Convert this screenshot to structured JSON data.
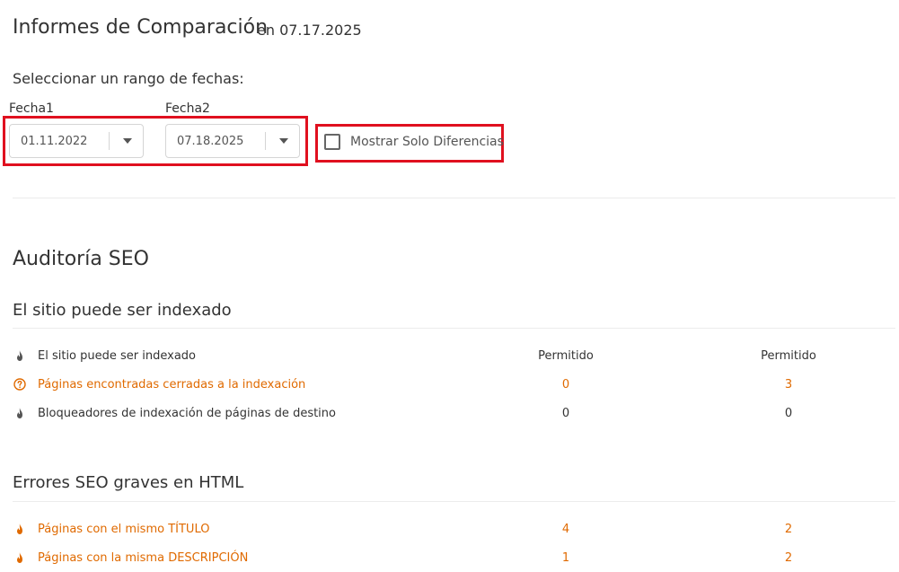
{
  "header": {
    "title": "Informes de Comparación",
    "date": "en 07.17.2025"
  },
  "date_range": {
    "label": "Seleccionar un rango de fechas:",
    "date1_label": "Fecha1",
    "date1_value": "01.11.2022",
    "date2_label": "Fecha2",
    "date2_value": "07.18.2025",
    "only_diff_label": "Mostrar Solo Diferencias",
    "only_diff_checked": false
  },
  "audit": {
    "title": "Auditoría SEO",
    "sections": [
      {
        "title": "El sitio puede ser indexado",
        "rows": [
          {
            "label": "El sitio puede ser indexado",
            "value1": "Permitido",
            "value2": "Permitido",
            "status": "ok",
            "icon": "fire-icon"
          },
          {
            "label": "Páginas encontradas cerradas a la indexación",
            "value1": "0",
            "value2": "3",
            "status": "warning",
            "icon": "question-circle-icon"
          },
          {
            "label": "Bloqueadores de indexación de páginas de destino",
            "value1": "0",
            "value2": "0",
            "status": "ok",
            "icon": "fire-icon"
          }
        ]
      },
      {
        "title": "Errores SEO graves en HTML",
        "rows": [
          {
            "label": "Páginas con el mismo TÍTULO",
            "value1": "4",
            "value2": "2",
            "status": "error",
            "icon": "fire-icon"
          },
          {
            "label": "Páginas con la misma DESCRIPCIÓN",
            "value1": "1",
            "value2": "2",
            "status": "error",
            "icon": "fire-icon"
          }
        ]
      }
    ]
  },
  "colors": {
    "accent_orange": "#e06a00",
    "highlight_red": "#e0101f",
    "icon_gray": "#555555"
  }
}
